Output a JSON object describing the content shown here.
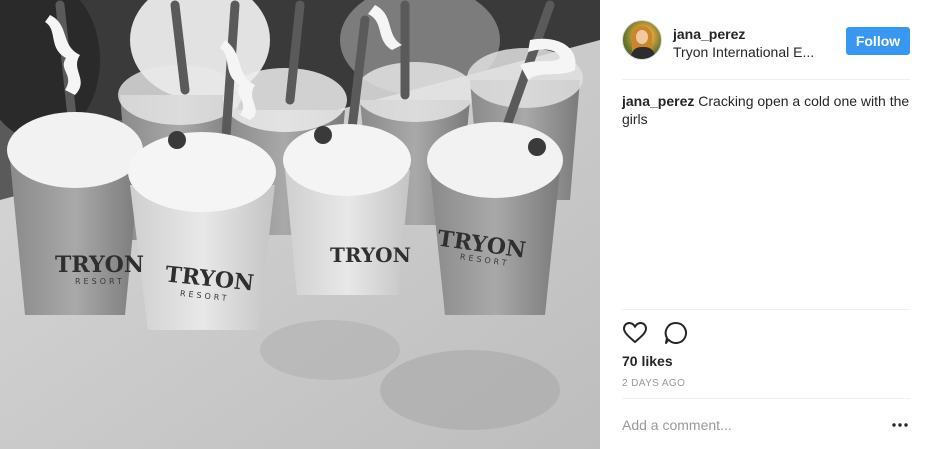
{
  "post": {
    "username": "jana_perez",
    "location": "Tryon International E...",
    "follow_label": "Follow",
    "caption_user": "jana_perez",
    "caption_text": "Cracking open a cold one with the girls",
    "likes": "70 likes",
    "date": "2 DAYS AGO",
    "comment_placeholder": "Add a comment...",
    "cup_logo_text": "TRYON",
    "cup_sub_text": "RESORT"
  },
  "icons": {
    "like": "heart-icon",
    "comment": "comment-bubble-icon",
    "more": "more-options-icon"
  },
  "colors": {
    "follow_button": "#3897f0",
    "text": "#262626",
    "muted": "#999999",
    "divider": "#efefef"
  }
}
